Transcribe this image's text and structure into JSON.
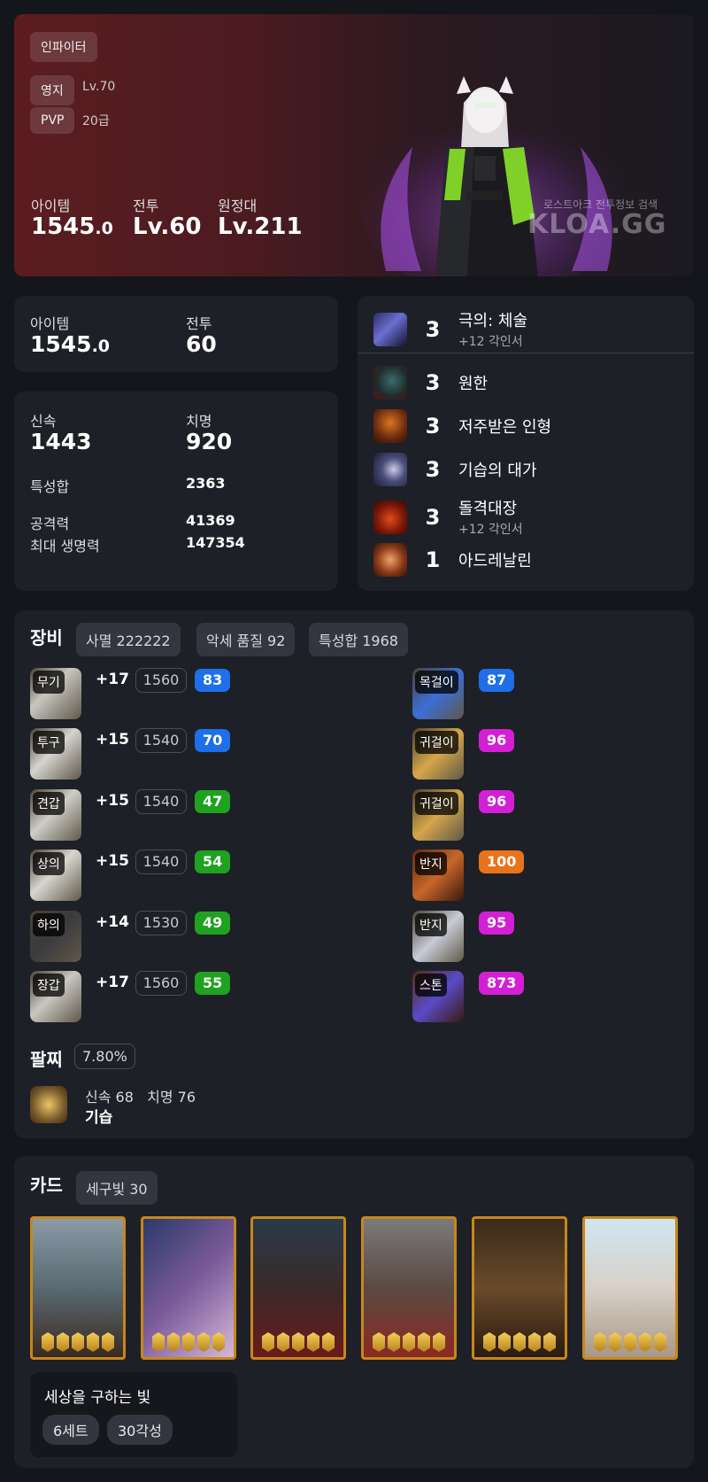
{
  "profile": {
    "class_name": "인파이터",
    "territory_label": "영지",
    "territory_value": "Lv.70",
    "pvp_label": "PVP",
    "pvp_value": "20급",
    "watermark_top": "로스트아크 전투정보 검색",
    "watermark_logo": "KLOA.GG",
    "stats": [
      {
        "label": "아이템",
        "value_main": "1545",
        "value_dec": ".0"
      },
      {
        "label": "전투",
        "value_main": "Lv.60",
        "value_dec": ""
      },
      {
        "label": "원정대",
        "value_main": "Lv.211",
        "value_dec": ""
      }
    ]
  },
  "level_panel": {
    "item_label": "아이템",
    "item_main": "1545",
    "item_dec": ".0",
    "combat_label": "전투",
    "combat_value": "60"
  },
  "stat_panel": {
    "swiftness_label": "신속",
    "swiftness_value": "1443",
    "crit_label": "치명",
    "crit_value": "920",
    "total_label": "특성합",
    "total_value": "2363",
    "attack_label": "공격력",
    "attack_value": "41369",
    "hp_label": "최대 생명력",
    "hp_value": "147354"
  },
  "engravings": {
    "class_engraving": {
      "level": "3",
      "name": "극의: 체술",
      "sub": "+12 각인서"
    },
    "items": [
      {
        "level": "3",
        "name": "원한",
        "sub": ""
      },
      {
        "level": "3",
        "name": "저주받은 인형",
        "sub": ""
      },
      {
        "level": "3",
        "name": "기습의 대가",
        "sub": ""
      },
      {
        "level": "3",
        "name": "돌격대장",
        "sub": "+12 각인서"
      },
      {
        "level": "1",
        "name": "아드레날린",
        "sub": ""
      }
    ]
  },
  "equipment": {
    "title": "장비",
    "badges": [
      "사멸 222222",
      "악세 품질 92",
      "특성합 1968"
    ],
    "armor": [
      {
        "slot": "무기",
        "plus": "+17",
        "ilvl": "1560",
        "quality": "83"
      },
      {
        "slot": "투구",
        "plus": "+15",
        "ilvl": "1540",
        "quality": "70"
      },
      {
        "slot": "견갑",
        "plus": "+15",
        "ilvl": "1540",
        "quality": "47"
      },
      {
        "slot": "상의",
        "plus": "+15",
        "ilvl": "1540",
        "quality": "54"
      },
      {
        "slot": "하의",
        "plus": "+14",
        "ilvl": "1530",
        "quality": "49"
      },
      {
        "slot": "장갑",
        "plus": "+17",
        "ilvl": "1560",
        "quality": "55"
      }
    ],
    "accessories": [
      {
        "slot": "목걸이",
        "quality": "87"
      },
      {
        "slot": "귀걸이",
        "quality": "96"
      },
      {
        "slot": "귀걸이",
        "quality": "96"
      },
      {
        "slot": "반지",
        "quality": "100"
      },
      {
        "slot": "반지",
        "quality": "95"
      },
      {
        "slot": "스톤",
        "quality": "873"
      }
    ],
    "quality_colors": {
      "blue": "#1e6fe8",
      "green": "#1fa21f",
      "magenta": "#d31fd6",
      "orange": "#e8731a"
    }
  },
  "bracelet": {
    "title": "팔찌",
    "percent": "7.80%",
    "stats_line": "신속 68   치명 76",
    "effect": "기습"
  },
  "cards": {
    "title": "카드",
    "set_badge": "세구빛 30",
    "set_name": "세상을 구하는 빛",
    "set_tags": [
      "6세트",
      "30각성"
    ],
    "card_border_color": "#c7871c"
  }
}
